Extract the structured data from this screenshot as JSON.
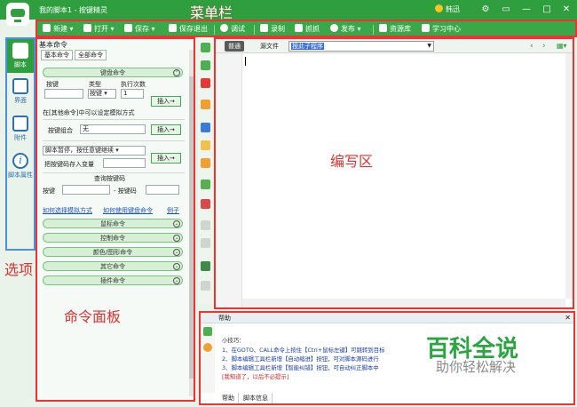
{
  "app": {
    "title": "我的脚本1 - 按键精灵",
    "menu_annotation": "菜单栏",
    "user": "韩迅",
    "win_controls": [
      "⚙",
      "▭",
      "—",
      "□",
      "✕"
    ]
  },
  "toolbar": {
    "items": [
      "新建",
      "打开",
      "保存",
      "保存退出",
      "调试",
      "录制",
      "抓抓",
      "发布",
      "资源库",
      "学习中心"
    ]
  },
  "leftnav": {
    "items": [
      {
        "label": "脚本",
        "icon": "script-icon"
      },
      {
        "label": "界面",
        "icon": "ui-icon"
      },
      {
        "label": "附件",
        "icon": "attachment-icon"
      },
      {
        "label": "脚本属性",
        "icon": "info-icon"
      }
    ],
    "annotation": "选项"
  },
  "cmdpanel": {
    "header": "基本命令",
    "tabs": [
      "基本命令",
      "全部命令"
    ],
    "keyboard_section": "键盘命令",
    "key_label": "按键",
    "type_label": "类型",
    "count_label": "执行次数",
    "type_value": "按键",
    "count_value": "1",
    "insert_label": "插入→",
    "other_note": "在[其他命令]中可以设定模拟方式",
    "combo_label": "按键组合",
    "combo_value": "无",
    "pause_select": "脚本暂停，按任意键继续",
    "save_var_label": "把按键码存入变量",
    "query_label": "查询按键码",
    "query_key_label": "按键",
    "query_code_label": "- 按键码",
    "links": [
      "如何选择模拟方式",
      "如何使用键盘命令",
      "例子"
    ],
    "sections": [
      "鼠标命令",
      "控制命令",
      "颜色/图形命令",
      "其它命令",
      "插件命令"
    ],
    "annotation": "命令面板"
  },
  "editor": {
    "tab_normal": "普通",
    "tab_source": "源文件",
    "select_text": "按此子程序",
    "annotation": "编写区"
  },
  "help": {
    "title": "帮助",
    "tip_title": "小技巧：",
    "lines": [
      "1、在GOTO、CALL命令上按住【Ctrl+鼠标左键】可跳转到目标",
      "2、脚本编辑工具栏新增【自动缩进】按钮，可对脚本源码进行",
      "3、脚本编辑工具栏新增【智能纠错】按钮，可自动纠正脚本中"
    ],
    "dismiss": "[我知道了，以后不必提示]",
    "tabs": [
      "帮助",
      "脚本信息"
    ]
  },
  "watermark": {
    "title": "百科全说",
    "subtitle": "助你轻松解决"
  },
  "colors": {
    "brand_green": "#2f9e3e",
    "annotation_red": "#e23030",
    "annotation_blue": "#4a8fe0"
  }
}
